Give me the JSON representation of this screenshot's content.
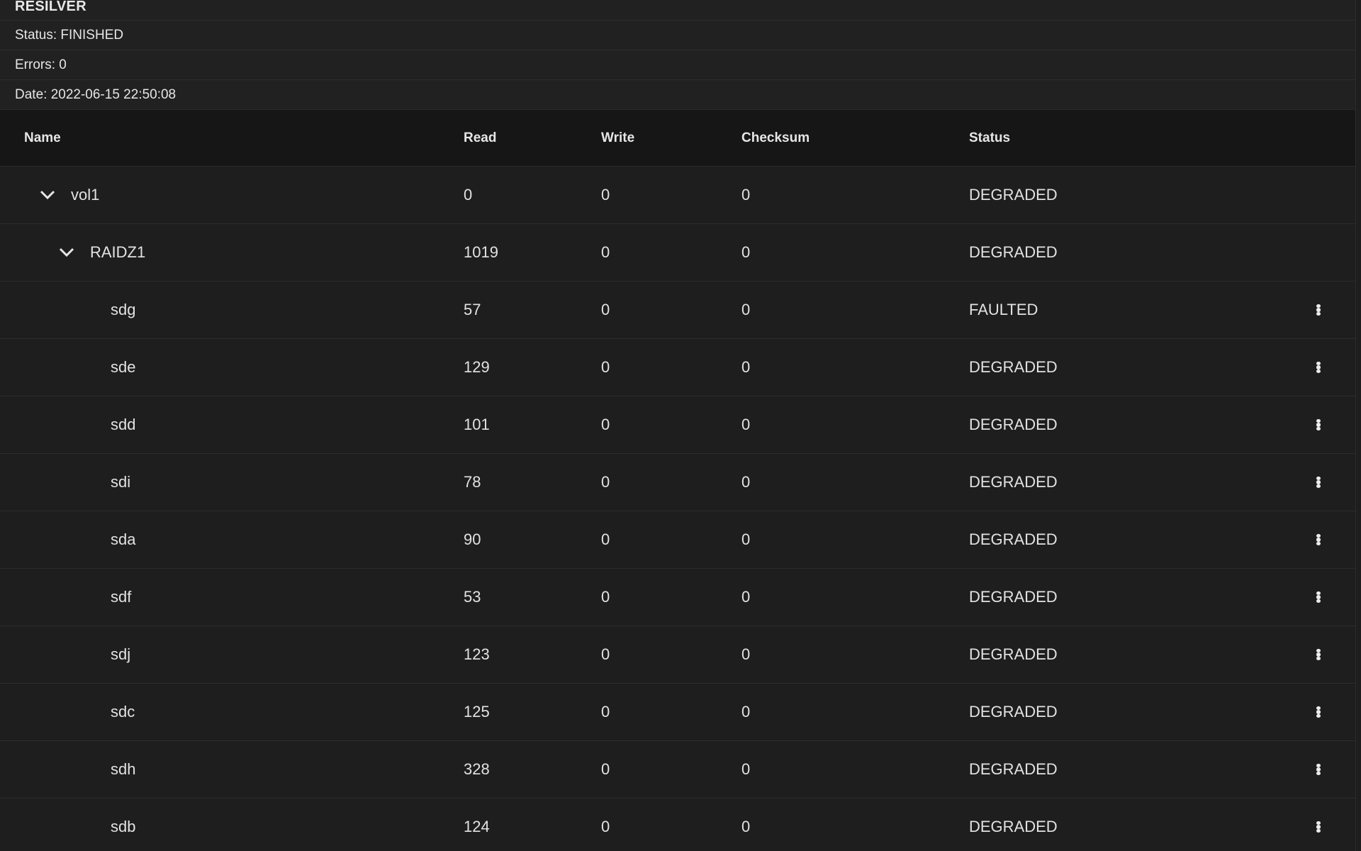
{
  "summary": {
    "title": "RESILVER",
    "status": "Status: FINISHED",
    "errors": "Errors: 0",
    "date": "Date: 2022-06-15 22:50:08"
  },
  "table": {
    "columns": {
      "name": "Name",
      "read": "Read",
      "write": "Write",
      "checksum": "Checksum",
      "status": "Status"
    },
    "pool": {
      "name": "vol1",
      "read": "0",
      "write": "0",
      "checksum": "0",
      "status": "DEGRADED",
      "expanded": true
    },
    "vdev": {
      "name": "RAIDZ1",
      "read": "1019",
      "write": "0",
      "checksum": "0",
      "status": "DEGRADED",
      "expanded": true
    },
    "disks": [
      {
        "name": "sdg",
        "read": "57",
        "write": "0",
        "checksum": "0",
        "status": "FAULTED"
      },
      {
        "name": "sde",
        "read": "129",
        "write": "0",
        "checksum": "0",
        "status": "DEGRADED"
      },
      {
        "name": "sdd",
        "read": "101",
        "write": "0",
        "checksum": "0",
        "status": "DEGRADED"
      },
      {
        "name": "sdi",
        "read": "78",
        "write": "0",
        "checksum": "0",
        "status": "DEGRADED"
      },
      {
        "name": "sda",
        "read": "90",
        "write": "0",
        "checksum": "0",
        "status": "DEGRADED"
      },
      {
        "name": "sdf",
        "read": "53",
        "write": "0",
        "checksum": "0",
        "status": "DEGRADED"
      },
      {
        "name": "sdj",
        "read": "123",
        "write": "0",
        "checksum": "0",
        "status": "DEGRADED"
      },
      {
        "name": "sdc",
        "read": "125",
        "write": "0",
        "checksum": "0",
        "status": "DEGRADED"
      },
      {
        "name": "sdh",
        "read": "328",
        "write": "0",
        "checksum": "0",
        "status": "DEGRADED"
      },
      {
        "name": "sdb",
        "read": "124",
        "write": "0",
        "checksum": "0",
        "status": "DEGRADED"
      }
    ]
  },
  "icons": {
    "expand": "chevron-down-icon",
    "row_menu": "more-vert-icon"
  },
  "colors": {
    "background": "#1e1e1e",
    "header_background": "#161616",
    "text": "#e6e6e6"
  }
}
